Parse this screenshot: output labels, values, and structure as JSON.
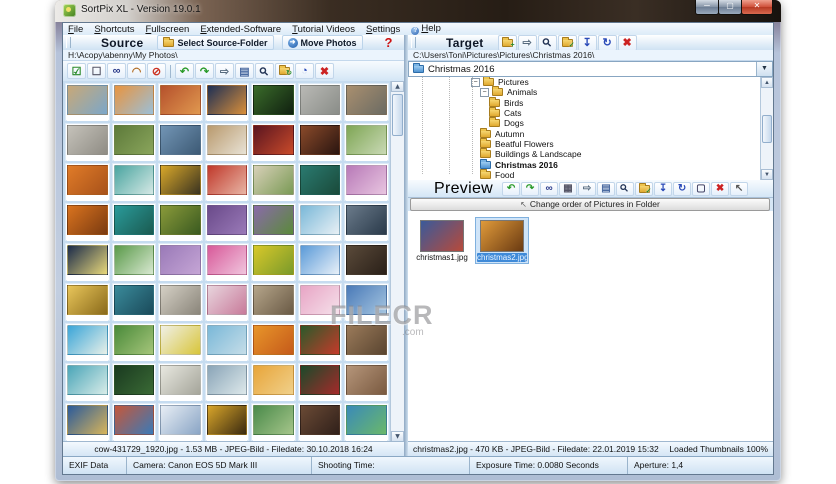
{
  "window": {
    "title": "SortPix XL - Version 19.0.1",
    "buttons": [
      "minimize",
      "maximize",
      "close"
    ]
  },
  "menu": {
    "items": [
      {
        "label": "File"
      },
      {
        "label": "Shortcuts"
      },
      {
        "label": "Fullscreen"
      },
      {
        "label": "Extended-Software"
      },
      {
        "label": "Tutorial Videos"
      },
      {
        "label": "Settings"
      },
      {
        "label": "Help",
        "icon": "help-icon"
      }
    ]
  },
  "source": {
    "header": {
      "label": "Source",
      "select_folder_button": "Select Source-Folder",
      "move_photos_button": "Move Photos",
      "help_label": "?"
    },
    "path": "H:\\Acopy\\abenny\\My Photos\\",
    "toolbar_icons": [
      "select-all-checkbox-icon",
      "deselect-checkbox-icon",
      "binoculars-icon",
      "bridge-panorama-icon",
      "globe-blocked-icon",
      "separator",
      "undo-icon",
      "redo-icon",
      "move-arrow-icon",
      "image-info-icon",
      "magnifier-icon",
      "folder-refresh-icon",
      "pie-chart-icon",
      "delete-icon"
    ],
    "status": "cow-431729_1920.jpg - 1.53 MB - JPEG-Bild - Filedate: 30.10.2018 16:24",
    "thumbnails": [
      [
        "#c8a878",
        "#7ba7c9"
      ],
      [
        "#e8943f",
        "#9bbfd8"
      ],
      [
        "#b5512c",
        "#e0984f"
      ],
      [
        "#1d2f55",
        "#d98f3a"
      ],
      [
        "#3a6b2a",
        "#102010"
      ],
      [
        "#b9b9b5",
        "#8a8d88"
      ],
      [
        "#a98f6f",
        "#6b6b63"
      ],
      [
        "#c5c2ba",
        "#8f8c84"
      ],
      [
        "#5d7a3a",
        "#8aa55c"
      ],
      [
        "#7295b5",
        "#3d5a75"
      ],
      [
        "#b99a6e",
        "#e8e2d5"
      ],
      [
        "#5a1520",
        "#c94a2a"
      ],
      [
        "#8a4a2a",
        "#2a1510"
      ],
      [
        "#7fa655",
        "#c9d9b5"
      ],
      [
        "#e07b28",
        "#a8521a"
      ],
      [
        "#4aa5a0",
        "#d5e8e5"
      ],
      [
        "#d9a82a",
        "#3a3320"
      ],
      [
        "#c0392b",
        "#e8b5a5"
      ],
      [
        "#d8d0b8",
        "#7a9a55"
      ],
      [
        "#2a7a70",
        "#1a4a3a"
      ],
      [
        "#b87ab8",
        "#e8c5e0"
      ],
      [
        "#d9731f",
        "#7a3a10"
      ],
      [
        "#2a9a9a",
        "#1a5a50"
      ],
      [
        "#8a9a3a",
        "#3a5a20"
      ],
      [
        "#6a4a8a",
        "#9a7ab8"
      ],
      [
        "#8a6aaa",
        "#5a8a3a"
      ],
      [
        "#7ab8d8",
        "#e8f0f5"
      ],
      [
        "#6a7a8a",
        "#2a3a4a"
      ],
      [
        "#1a2a4a",
        "#e8d87a"
      ],
      [
        "#5a9a4a",
        "#d8e8d0"
      ],
      [
        "#9a7ab8",
        "#c5a5d5"
      ],
      [
        "#d85a9a",
        "#f0c5dd"
      ],
      [
        "#d8c82a",
        "#7a9a2a"
      ],
      [
        "#5a9ad8",
        "#e8f0f8"
      ],
      [
        "#5a4a3a",
        "#2a2018"
      ],
      [
        "#e8c55a",
        "#8a6a1a"
      ],
      [
        "#3a8a9a",
        "#1a4a5a"
      ],
      [
        "#d5d0c5",
        "#8a857a"
      ],
      [
        "#e8d5dd",
        "#c87a9a"
      ],
      [
        "#b5a58a",
        "#6a5a45"
      ],
      [
        "#e8a5c5",
        "#f5e0ea"
      ],
      [
        "#4a7ab8",
        "#a5c5e0"
      ],
      [
        "#3aa5d8",
        "#e8f0e8"
      ],
      [
        "#4a8a3a",
        "#a5c57a"
      ],
      [
        "#f0f0e8",
        "#d8c53a"
      ],
      [
        "#7ab8d8",
        "#c5dde8"
      ],
      [
        "#e8952a",
        "#c55a1a"
      ],
      [
        "#2a5a2a",
        "#c53a2a"
      ],
      [
        "#9a7a5a",
        "#5a4530"
      ],
      [
        "#4aa5b8",
        "#d8ece8"
      ],
      [
        "#1a3a20",
        "#3a6a35"
      ],
      [
        "#e8e8e0",
        "#a5a59a"
      ],
      [
        "#8aa5b8",
        "#dde8ea"
      ],
      [
        "#e8a53a",
        "#f0d08a"
      ],
      [
        "#1a4a2a",
        "#a52a2a"
      ],
      [
        "#b5957a",
        "#7a5a40"
      ],
      [
        "#2a5a9a",
        "#d8b55a"
      ],
      [
        "#c5573a",
        "#3a7ab8"
      ],
      [
        "#e8eef5",
        "#8aa5c5"
      ],
      [
        "#d8a52a",
        "#3a2a10"
      ],
      [
        "#4a8a4a",
        "#a5c58a"
      ],
      [
        "#6a4a35",
        "#30201a"
      ],
      [
        "#3a8ab8",
        "#6ab86a"
      ]
    ]
  },
  "target": {
    "header": {
      "label": "Target"
    },
    "toolbar_icons": [
      "new-folder-icon",
      "move-arrow-icon",
      "magnifier-icon",
      "folder-check-icon",
      "send-to-folder-icon",
      "refresh-icon",
      "delete-icon"
    ],
    "path": "C:\\Users\\Toni\\Pictures\\Pictures\\Christmas 2016\\",
    "folder_dropdown": "Christmas 2016",
    "tree": [
      {
        "label": "Pictures",
        "level": 5,
        "expander": true,
        "folder": "yellow"
      },
      {
        "label": "Animals",
        "level": 6,
        "expander": true,
        "folder": "yellow"
      },
      {
        "label": "Birds",
        "level": 7,
        "folder": "yellow"
      },
      {
        "label": "Cats",
        "level": 7,
        "folder": "yellow"
      },
      {
        "label": "Dogs",
        "level": 7,
        "folder": "yellow"
      },
      {
        "label": "Autumn",
        "level": 6,
        "folder": "yellow"
      },
      {
        "label": "Beatful Flowers",
        "level": 6,
        "folder": "yellow"
      },
      {
        "label": "Buildings & Landscape",
        "level": 6,
        "folder": "yellow"
      },
      {
        "label": "Christmas 2016",
        "level": 6,
        "folder": "blue",
        "selected": true
      },
      {
        "label": "Food",
        "level": 6,
        "folder": "yellow"
      }
    ],
    "preview": {
      "label": "Preview",
      "toolbar_icons": [
        "undo-icon",
        "redo-icon",
        "binoculars-icon",
        "filmstrip-icon",
        "move-arrow-icon",
        "image-info-icon",
        "magnifier-icon",
        "folder-check-icon",
        "send-to-folder-icon",
        "refresh-icon",
        "fullscreen-icon",
        "delete-icon",
        "order-cursor-icon"
      ],
      "order_button": "Change order of Pictures in Folder",
      "files": [
        {
          "name": "christmas1.jpg",
          "selected": false,
          "colors": [
            "#3a5a9a",
            "#b84a3a"
          ]
        },
        {
          "name": "christmas2.jpg",
          "selected": true,
          "colors": [
            "#e09a3a",
            "#6a3a12"
          ]
        }
      ]
    },
    "status_left": "christmas2.jpg - 470 KB - JPEG-Bild - Filedate: 22.01.2019 15:32",
    "status_right": "Loaded Thumbnails 100%"
  },
  "statusbar": {
    "segments": [
      "EXIF Data",
      "Camera: Canon EOS 5D Mark III",
      "Shooting Time:",
      "Exposure Time: 0.0080 Seconds",
      "Aperture: 1,4"
    ]
  },
  "watermark": {
    "line1": "FILECR",
    "line2": ".com"
  },
  "colors": {
    "selection_blue": "#3f8ad8",
    "panel_blue": "#d6e6f5",
    "grid_blue": "#c6dcf0",
    "folder_yellow": "#eec44e",
    "close_red": "#c23a28"
  }
}
